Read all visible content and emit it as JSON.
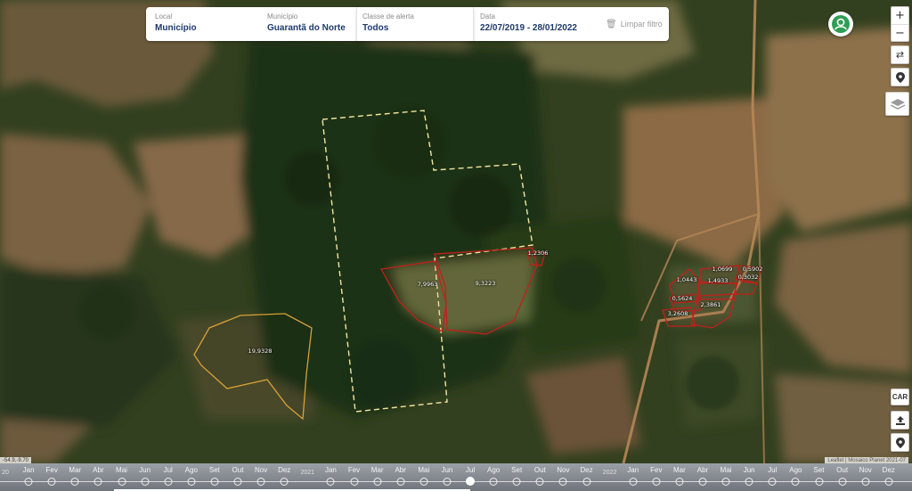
{
  "filters": {
    "local": {
      "label": "Local",
      "value": "Município"
    },
    "municipio": {
      "label": "Município",
      "value": "Guarantã do Norte"
    },
    "classe": {
      "label": "Classe de alerta",
      "value": "Todos"
    },
    "data": {
      "label": "Data",
      "value": "22/07/2019 - 28/01/2022"
    },
    "clear_label": "Limpar filtro"
  },
  "map": {
    "polygons": [
      {
        "label": "19,9328",
        "status": "cleared",
        "color": "#d8a038"
      },
      {
        "label": "7,9963",
        "status": "alert",
        "color": "#c0201c"
      },
      {
        "label": "9,3223",
        "status": "alert",
        "color": "#c0201c"
      },
      {
        "label": "1,2306",
        "status": "alert",
        "color": "#c0201c"
      },
      {
        "label": "1,0443",
        "status": "alert",
        "color": "#c0201c"
      },
      {
        "label": "1,0699",
        "status": "alert",
        "color": "#c0201c"
      },
      {
        "label": "0,5902",
        "status": "alert",
        "color": "#c0201c"
      },
      {
        "label": "1,4933",
        "status": "alert",
        "color": "#c0201c"
      },
      {
        "label": "0,3032",
        "status": "alert",
        "color": "#c0201c"
      },
      {
        "label": "0,5624",
        "status": "alert",
        "color": "#c0201c"
      },
      {
        "label": "2,3861",
        "status": "alert",
        "color": "#c0201c"
      },
      {
        "label": "3,2608",
        "status": "alert",
        "color": "#c0201c"
      }
    ],
    "property_boundary_color": "#f2e6a0",
    "attribution": "Leaflet | Mosaico Planet 2021-07",
    "coords": "-54.9,-9.70"
  },
  "controls": {
    "zoom_in": "+",
    "zoom_out": "−",
    "car_label": "CAR"
  },
  "timeline": {
    "items": [
      {
        "label": "20",
        "kind": "year"
      },
      {
        "label": "Jan"
      },
      {
        "label": "Fev"
      },
      {
        "label": "Mar"
      },
      {
        "label": "Abr"
      },
      {
        "label": "Mai"
      },
      {
        "label": "Jun"
      },
      {
        "label": "Jul"
      },
      {
        "label": "Ago"
      },
      {
        "label": "Set"
      },
      {
        "label": "Out"
      },
      {
        "label": "Nov"
      },
      {
        "label": "Dez"
      },
      {
        "label": "2021",
        "kind": "year"
      },
      {
        "label": "Jan"
      },
      {
        "label": "Fev"
      },
      {
        "label": "Mar"
      },
      {
        "label": "Abr"
      },
      {
        "label": "Mai"
      },
      {
        "label": "Jun"
      },
      {
        "label": "Jul",
        "active": true
      },
      {
        "label": "Ago"
      },
      {
        "label": "Set"
      },
      {
        "label": "Out"
      },
      {
        "label": "Nov"
      },
      {
        "label": "Dez"
      },
      {
        "label": "2022",
        "kind": "year"
      },
      {
        "label": "Jan"
      },
      {
        "label": "Fev"
      },
      {
        "label": "Mar"
      },
      {
        "label": "Abr"
      },
      {
        "label": "Mai"
      },
      {
        "label": "Jun"
      },
      {
        "label": "Jul"
      },
      {
        "label": "Ago"
      },
      {
        "label": "Set"
      },
      {
        "label": "Out"
      },
      {
        "label": "Nov"
      },
      {
        "label": "Dez"
      }
    ]
  }
}
